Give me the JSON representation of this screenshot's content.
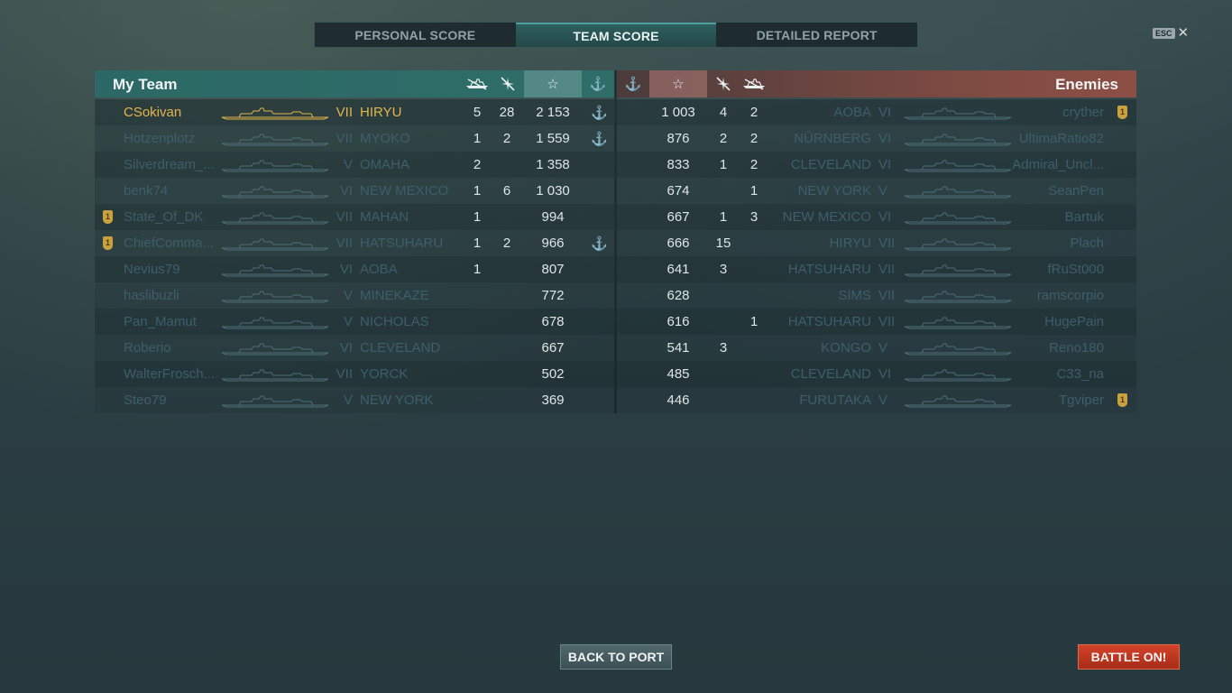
{
  "tabs": [
    {
      "label": "PERSONAL SCORE"
    },
    {
      "label": "TEAM SCORE"
    },
    {
      "label": "DETAILED REPORT"
    }
  ],
  "esc": {
    "key": "ESC",
    "close": "✕"
  },
  "my_team": {
    "title": "My Team",
    "rows": [
      {
        "player": "CSokivan",
        "tier": "VII",
        "ship": "HIRYU",
        "kills_a": "5",
        "kills_b": "28",
        "score": "2 153",
        "anchor": "⚓"
      },
      {
        "player": "Hotzenplotz",
        "tier": "VII",
        "ship": "MYOKO",
        "kills_a": "1",
        "kills_b": "2",
        "score": "1 559",
        "anchor": "⚓"
      },
      {
        "player": "Silverdream_...",
        "tier": "V",
        "ship": "OMAHA",
        "kills_a": "2",
        "kills_b": "",
        "score": "1 358",
        "anchor": ""
      },
      {
        "player": "benk74",
        "tier": "VI",
        "ship": "NEW MEXICO",
        "kills_a": "1",
        "kills_b": "6",
        "score": "1 030",
        "anchor": ""
      },
      {
        "player": "State_Of_DK",
        "tier": "VII",
        "ship": "MAHAN",
        "kills_a": "1",
        "kills_b": "",
        "score": "994",
        "anchor": "",
        "medal": "1"
      },
      {
        "player": "ChiefComma...",
        "tier": "VII",
        "ship": "HATSUHARU",
        "kills_a": "1",
        "kills_b": "2",
        "score": "966",
        "anchor": "⚓",
        "medal": "1"
      },
      {
        "player": "Nevius79",
        "tier": "VI",
        "ship": "AOBA",
        "kills_a": "1",
        "kills_b": "",
        "score": "807",
        "anchor": ""
      },
      {
        "player": "haslibuzli",
        "tier": "V",
        "ship": "MINEKAZE",
        "kills_a": "",
        "kills_b": "",
        "score": "772",
        "anchor": ""
      },
      {
        "player": "Pan_Mamut",
        "tier": "V",
        "ship": "NICHOLAS",
        "kills_a": "",
        "kills_b": "",
        "score": "678",
        "anchor": ""
      },
      {
        "player": "Roberio",
        "tier": "VI",
        "ship": "CLEVELAND",
        "kills_a": "",
        "kills_b": "",
        "score": "667",
        "anchor": ""
      },
      {
        "player": "WalterFrosch...",
        "tier": "VII",
        "ship": "YORCK",
        "kills_a": "",
        "kills_b": "",
        "score": "502",
        "anchor": ""
      },
      {
        "player": "Steo79",
        "tier": "V",
        "ship": "NEW YORK",
        "kills_a": "",
        "kills_b": "",
        "score": "369",
        "anchor": ""
      }
    ]
  },
  "enemies": {
    "title": "Enemies",
    "rows": [
      {
        "score": "1 003",
        "kills_b": "4",
        "kills_a": "2",
        "ship": "AOBA",
        "tier": "VI",
        "player": "cryther",
        "medal": "1"
      },
      {
        "score": "876",
        "kills_b": "2",
        "kills_a": "2",
        "ship": "NÜRNBERG",
        "tier": "VI",
        "player": "UltimaRatio82"
      },
      {
        "score": "833",
        "kills_b": "1",
        "kills_a": "2",
        "ship": "CLEVELAND",
        "tier": "VI",
        "player": "Admiral_Uncl..."
      },
      {
        "score": "674",
        "kills_b": "",
        "kills_a": "1",
        "ship": "NEW YORK",
        "tier": "V",
        "player": "SeanPen"
      },
      {
        "score": "667",
        "kills_b": "1",
        "kills_a": "3",
        "ship": "NEW MEXICO",
        "tier": "VI",
        "player": "Bartuk"
      },
      {
        "score": "666",
        "kills_b": "15",
        "kills_a": "",
        "ship": "HIRYU",
        "tier": "VII",
        "player": "Plach"
      },
      {
        "score": "641",
        "kills_b": "3",
        "kills_a": "",
        "ship": "HATSUHARU",
        "tier": "VII",
        "player": "fRuSt000"
      },
      {
        "score": "628",
        "kills_b": "",
        "kills_a": "",
        "ship": "SIMS",
        "tier": "VII",
        "player": "ramscorpio"
      },
      {
        "score": "616",
        "kills_b": "",
        "kills_a": "1",
        "ship": "HATSUHARU",
        "tier": "VII",
        "player": "HugePain"
      },
      {
        "score": "541",
        "kills_b": "3",
        "kills_a": "",
        "ship": "KONGO",
        "tier": "V",
        "player": "Reno180"
      },
      {
        "score": "485",
        "kills_b": "",
        "kills_a": "",
        "ship": "CLEVELAND",
        "tier": "VI",
        "player": "C33_na"
      },
      {
        "score": "446",
        "kills_b": "",
        "kills_a": "",
        "ship": "FURUTAKA",
        "tier": "V",
        "player": "Tgviper",
        "medal": "1"
      }
    ]
  },
  "header_icons": {
    "ship_kills": "ship-kill-icon",
    "plane_kills": "plane-kill-icon",
    "score": "☆",
    "base": "⚓"
  },
  "buttons": {
    "back_to_port": "BACK TO PORT",
    "battle_on": "BATTLE ON!"
  },
  "colors": {
    "my_team_header": "#2c6966",
    "enemy_header": "#8d4f45",
    "highlight_player": "#e3b54a",
    "battle_button": "#c23a22"
  }
}
